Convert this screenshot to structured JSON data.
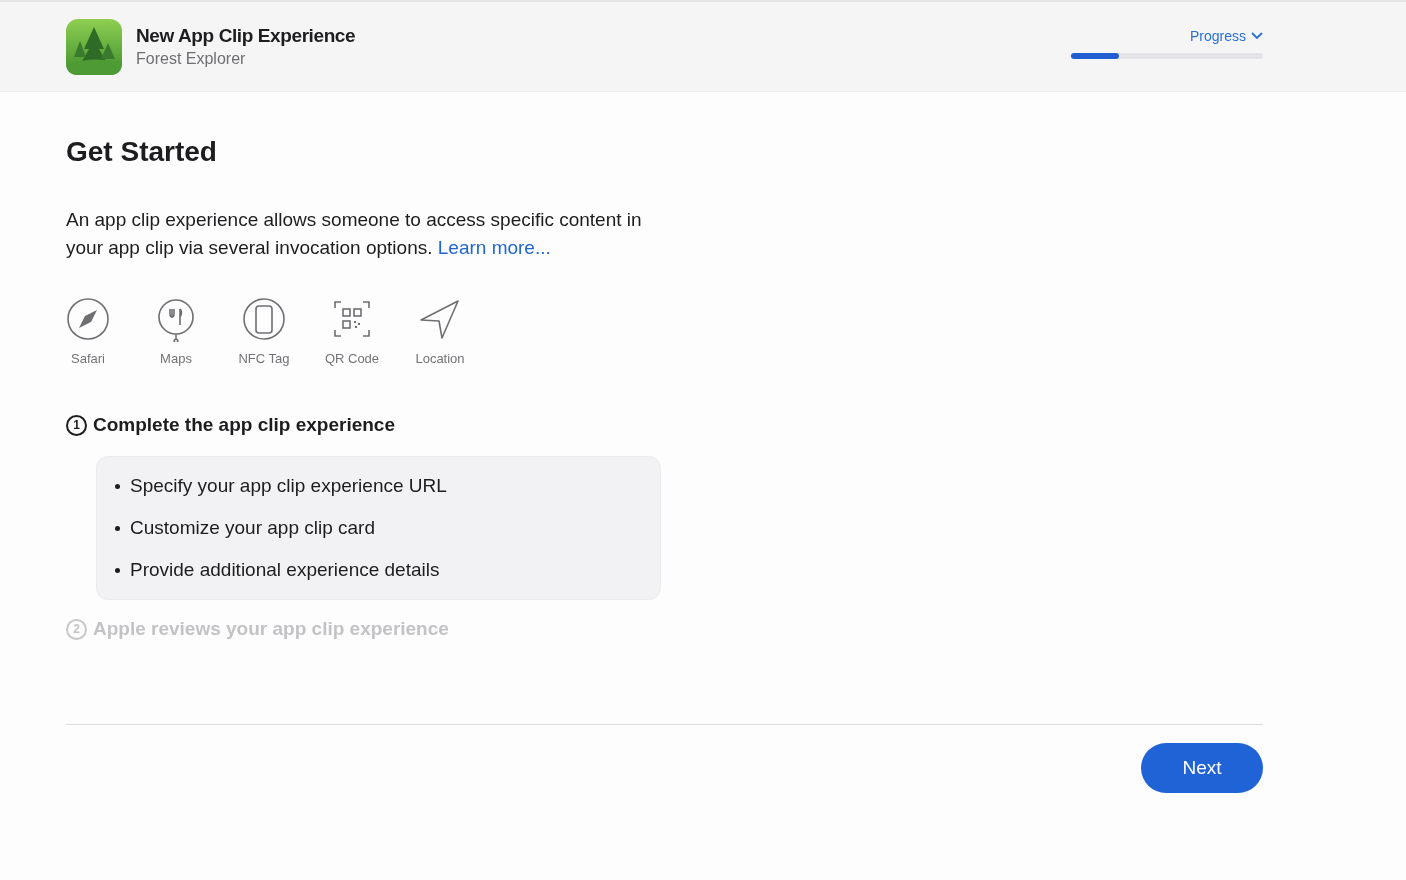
{
  "header": {
    "title": "New App Clip Experience",
    "subtitle": "Forest Explorer",
    "progress": {
      "label": "Progress",
      "level": 0.25
    }
  },
  "heading": "Get Started",
  "intro": {
    "text": "An app clip experience allows someone to access specific content in your app clip via several invocation options.",
    "link": "Learn more..."
  },
  "invocations": [
    {
      "kind": "safari",
      "label": "Safari"
    },
    {
      "kind": "maps",
      "label": "Maps"
    },
    {
      "kind": "nfc",
      "label": "NFC Tag"
    },
    {
      "kind": "qr",
      "label": "QR Code"
    },
    {
      "kind": "location",
      "label": "Location"
    }
  ],
  "steps": [
    {
      "number": "1",
      "title": "Complete the app clip experience",
      "active": true,
      "items": [
        "Specify your app clip experience URL",
        "Customize your app clip card",
        "Provide additional experience details"
      ]
    },
    {
      "number": "2",
      "title": "Apple reviews your app clip experience",
      "active": false
    }
  ],
  "next_button": "Next"
}
